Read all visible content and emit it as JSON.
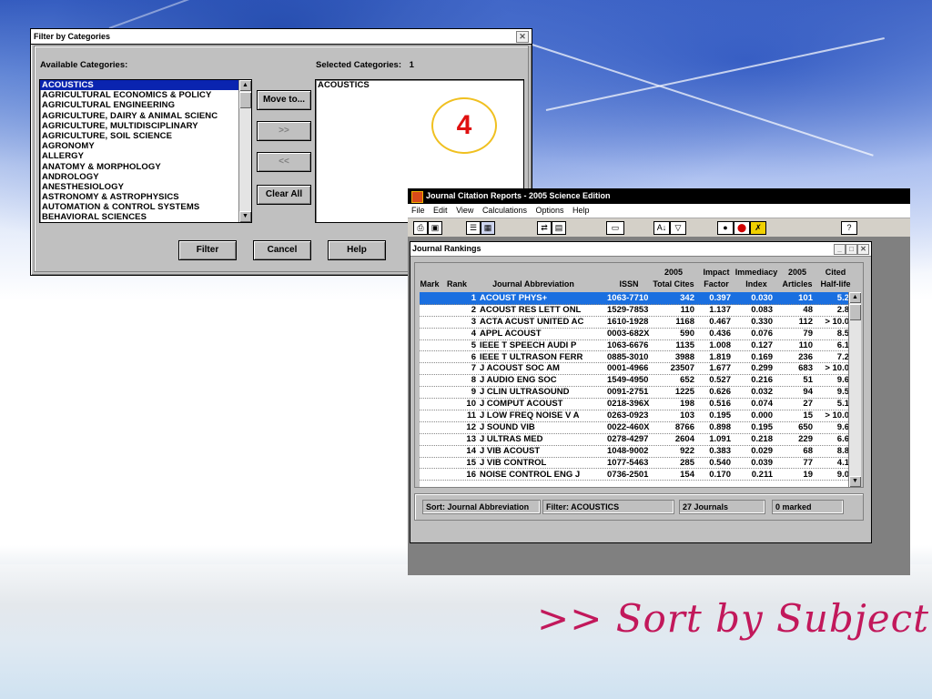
{
  "filter_dialog": {
    "title": "Filter by Categories",
    "available_label": "Available Categories:",
    "selected_label": "Selected Categories:",
    "selected_count": "1",
    "available_items": [
      "ACOUSTICS",
      "AGRICULTURAL ECONOMICS & POLICY",
      "AGRICULTURAL ENGINEERING",
      "AGRICULTURE, DAIRY & ANIMAL SCIENC",
      "AGRICULTURE, MULTIDISCIPLINARY",
      "AGRICULTURE, SOIL SCIENCE",
      "AGRONOMY",
      "ALLERGY",
      "ANATOMY & MORPHOLOGY",
      "ANDROLOGY",
      "ANESTHESIOLOGY",
      "ASTRONOMY & ASTROPHYSICS",
      "AUTOMATION & CONTROL SYSTEMS",
      "BEHAVIORAL SCIENCES"
    ],
    "selected_items": [
      "ACOUSTICS"
    ],
    "buttons": {
      "move_to": "Move to...",
      "add_all": ">>",
      "remove_all": "<<",
      "clear_all": "Clear All",
      "filter": "Filter",
      "cancel": "Cancel",
      "help": "Help"
    },
    "step_badge": "4"
  },
  "jcr_window": {
    "title": "Journal Citation Reports - 2005 Science Edition",
    "menu": [
      "File",
      "Edit",
      "View",
      "Calculations",
      "Options",
      "Help"
    ],
    "inner_title": "Journal Rankings",
    "columns": {
      "mark": "Mark",
      "rank": "Rank",
      "abbrev": "Journal Abbreviation",
      "issn": "ISSN",
      "cites_top": "2005",
      "cites_bottom": "Total Cites",
      "if_top": "Impact",
      "if_bottom": "Factor",
      "imm_top": "Immediacy",
      "imm_bottom": "Index",
      "art_top": "2005",
      "art_bottom": "Articles",
      "hl_top": "Cited",
      "hl_bottom": "Half-life"
    },
    "rows": [
      {
        "rank": "1",
        "abbrev": "ACOUST PHYS+",
        "issn": "1063-7710",
        "cites": "342",
        "if": "0.397",
        "imm": "0.030",
        "art": "101",
        "hl": "5.2"
      },
      {
        "rank": "2",
        "abbrev": "ACOUST RES LETT ONL",
        "issn": "1529-7853",
        "cites": "110",
        "if": "1.137",
        "imm": "0.083",
        "art": "48",
        "hl": "2.8"
      },
      {
        "rank": "3",
        "abbrev": "ACTA ACUST UNITED AC",
        "issn": "1610-1928",
        "cites": "1168",
        "if": "0.467",
        "imm": "0.330",
        "art": "112",
        "hl": "> 10.0"
      },
      {
        "rank": "4",
        "abbrev": "APPL ACOUST",
        "issn": "0003-682X",
        "cites": "590",
        "if": "0.436",
        "imm": "0.076",
        "art": "79",
        "hl": "8.5"
      },
      {
        "rank": "5",
        "abbrev": "IEEE T SPEECH AUDI P",
        "issn": "1063-6676",
        "cites": "1135",
        "if": "1.008",
        "imm": "0.127",
        "art": "110",
        "hl": "6.1"
      },
      {
        "rank": "6",
        "abbrev": "IEEE T ULTRASON FERR",
        "issn": "0885-3010",
        "cites": "3988",
        "if": "1.819",
        "imm": "0.169",
        "art": "236",
        "hl": "7.2"
      },
      {
        "rank": "7",
        "abbrev": "J ACOUST SOC AM",
        "issn": "0001-4966",
        "cites": "23507",
        "if": "1.677",
        "imm": "0.299",
        "art": "683",
        "hl": "> 10.0"
      },
      {
        "rank": "8",
        "abbrev": "J AUDIO ENG SOC",
        "issn": "1549-4950",
        "cites": "652",
        "if": "0.527",
        "imm": "0.216",
        "art": "51",
        "hl": "9.6"
      },
      {
        "rank": "9",
        "abbrev": "J CLIN ULTRASOUND",
        "issn": "0091-2751",
        "cites": "1225",
        "if": "0.626",
        "imm": "0.032",
        "art": "94",
        "hl": "9.5"
      },
      {
        "rank": "10",
        "abbrev": "J COMPUT ACOUST",
        "issn": "0218-396X",
        "cites": "198",
        "if": "0.516",
        "imm": "0.074",
        "art": "27",
        "hl": "5.1"
      },
      {
        "rank": "11",
        "abbrev": "J LOW FREQ NOISE V A",
        "issn": "0263-0923",
        "cites": "103",
        "if": "0.195",
        "imm": "0.000",
        "art": "15",
        "hl": "> 10.0"
      },
      {
        "rank": "12",
        "abbrev": "J SOUND VIB",
        "issn": "0022-460X",
        "cites": "8766",
        "if": "0.898",
        "imm": "0.195",
        "art": "650",
        "hl": "9.6"
      },
      {
        "rank": "13",
        "abbrev": "J ULTRAS MED",
        "issn": "0278-4297",
        "cites": "2604",
        "if": "1.091",
        "imm": "0.218",
        "art": "229",
        "hl": "6.6"
      },
      {
        "rank": "14",
        "abbrev": "J VIB ACOUST",
        "issn": "1048-9002",
        "cites": "922",
        "if": "0.383",
        "imm": "0.029",
        "art": "68",
        "hl": "8.8"
      },
      {
        "rank": "15",
        "abbrev": "J VIB CONTROL",
        "issn": "1077-5463",
        "cites": "285",
        "if": "0.540",
        "imm": "0.039",
        "art": "77",
        "hl": "4.1"
      },
      {
        "rank": "16",
        "abbrev": "NOISE CONTROL ENG J",
        "issn": "0736-2501",
        "cites": "154",
        "if": "0.170",
        "imm": "0.211",
        "art": "19",
        "hl": "9.0"
      }
    ],
    "status": {
      "sort": "Sort: Journal Abbreviation",
      "filter": "Filter: ACOUSTICS",
      "count": "27 Journals",
      "marked": "0 marked"
    }
  },
  "slogan": ">> Sort by Subject",
  "colors": {
    "selection": "#0a24b0",
    "row_selection": "#1a6fe0",
    "badge_ring": "#f0c020",
    "badge_text": "#e01010",
    "slogan": "#c2185b"
  }
}
